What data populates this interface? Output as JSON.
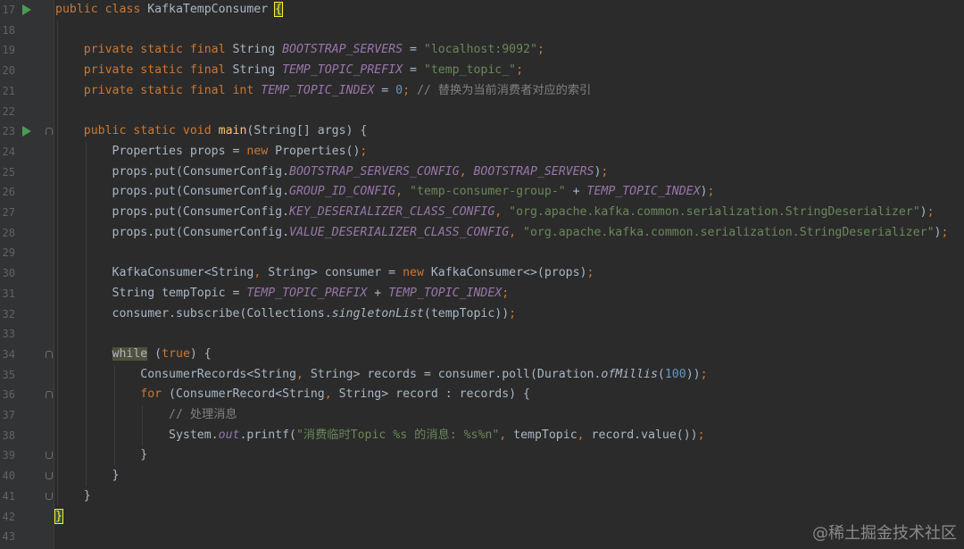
{
  "editor": {
    "lines": [
      {
        "num": "17",
        "run": true,
        "fold": null,
        "tokens": [
          [
            "kw",
            "public class "
          ],
          [
            "plain",
            "KafkaTempConsumer "
          ],
          [
            "brace",
            "{"
          ]
        ]
      },
      {
        "num": "18",
        "run": false,
        "fold": null,
        "tokens": []
      },
      {
        "num": "19",
        "run": false,
        "fold": null,
        "tokens": [
          [
            "plain",
            "    "
          ],
          [
            "kw",
            "private static final "
          ],
          [
            "plain",
            "String "
          ],
          [
            "const",
            "BOOTSTRAP_SERVERS"
          ],
          [
            "plain",
            " = "
          ],
          [
            "str",
            "\"localhost:9092\""
          ],
          [
            "kw",
            ";"
          ]
        ]
      },
      {
        "num": "20",
        "run": false,
        "fold": null,
        "tokens": [
          [
            "plain",
            "    "
          ],
          [
            "kw",
            "private static final "
          ],
          [
            "plain",
            "String "
          ],
          [
            "const",
            "TEMP_TOPIC_PREFIX"
          ],
          [
            "plain",
            " = "
          ],
          [
            "str",
            "\"temp_topic_\""
          ],
          [
            "kw",
            ";"
          ]
        ]
      },
      {
        "num": "21",
        "run": false,
        "fold": null,
        "tokens": [
          [
            "plain",
            "    "
          ],
          [
            "kw",
            "private static final int "
          ],
          [
            "const",
            "TEMP_TOPIC_INDEX"
          ],
          [
            "plain",
            " = "
          ],
          [
            "num",
            "0"
          ],
          [
            "kw",
            "; "
          ],
          [
            "com",
            "// 替换为当前消费者对应的索引"
          ]
        ]
      },
      {
        "num": "22",
        "run": false,
        "fold": null,
        "tokens": []
      },
      {
        "num": "23",
        "run": true,
        "fold": "open",
        "tokens": [
          [
            "plain",
            "    "
          ],
          [
            "kw",
            "public static void "
          ],
          [
            "fn",
            "main"
          ],
          [
            "plain",
            "(String[] args) {"
          ]
        ]
      },
      {
        "num": "24",
        "run": false,
        "fold": null,
        "tokens": [
          [
            "plain",
            "        Properties props = "
          ],
          [
            "kw",
            "new "
          ],
          [
            "plain",
            "Properties()"
          ],
          [
            "kw",
            ";"
          ]
        ]
      },
      {
        "num": "25",
        "run": false,
        "fold": null,
        "tokens": [
          [
            "plain",
            "        props.put(ConsumerConfig."
          ],
          [
            "const",
            "BOOTSTRAP_SERVERS_CONFIG"
          ],
          [
            "kw",
            ", "
          ],
          [
            "const",
            "BOOTSTRAP_SERVERS"
          ],
          [
            "plain",
            ")"
          ],
          [
            "kw",
            ";"
          ]
        ]
      },
      {
        "num": "26",
        "run": false,
        "fold": null,
        "tokens": [
          [
            "plain",
            "        props.put(ConsumerConfig."
          ],
          [
            "const",
            "GROUP_ID_CONFIG"
          ],
          [
            "kw",
            ", "
          ],
          [
            "str",
            "\"temp-consumer-group-\""
          ],
          [
            "plain",
            " + "
          ],
          [
            "const",
            "TEMP_TOPIC_INDEX"
          ],
          [
            "plain",
            ")"
          ],
          [
            "kw",
            ";"
          ]
        ]
      },
      {
        "num": "27",
        "run": false,
        "fold": null,
        "tokens": [
          [
            "plain",
            "        props.put(ConsumerConfig."
          ],
          [
            "const",
            "KEY_DESERIALIZER_CLASS_CONFIG"
          ],
          [
            "kw",
            ", "
          ],
          [
            "str",
            "\"org.apache.kafka.common.serialization.StringDeserializer\""
          ],
          [
            "plain",
            ")"
          ],
          [
            "kw",
            ";"
          ]
        ]
      },
      {
        "num": "28",
        "run": false,
        "fold": null,
        "tokens": [
          [
            "plain",
            "        props.put(ConsumerConfig."
          ],
          [
            "const",
            "VALUE_DESERIALIZER_CLASS_CONFIG"
          ],
          [
            "kw",
            ", "
          ],
          [
            "str",
            "\"org.apache.kafka.common.serialization.StringDeserializer\""
          ],
          [
            "plain",
            ")"
          ],
          [
            "kw",
            ";"
          ]
        ]
      },
      {
        "num": "29",
        "run": false,
        "fold": null,
        "tokens": []
      },
      {
        "num": "30",
        "run": false,
        "fold": null,
        "tokens": [
          [
            "plain",
            "        KafkaConsumer<String"
          ],
          [
            "kw",
            ", "
          ],
          [
            "plain",
            "String> consumer = "
          ],
          [
            "kw",
            "new "
          ],
          [
            "plain",
            "KafkaConsumer<>(props)"
          ],
          [
            "kw",
            ";"
          ]
        ]
      },
      {
        "num": "31",
        "run": false,
        "fold": null,
        "tokens": [
          [
            "plain",
            "        String tempTopic = "
          ],
          [
            "const",
            "TEMP_TOPIC_PREFIX"
          ],
          [
            "plain",
            " + "
          ],
          [
            "const",
            "TEMP_TOPIC_INDEX"
          ],
          [
            "kw",
            ";"
          ]
        ]
      },
      {
        "num": "32",
        "run": false,
        "fold": null,
        "tokens": [
          [
            "plain",
            "        consumer.subscribe(Collections."
          ],
          [
            "stat",
            "singletonList"
          ],
          [
            "plain",
            "(tempTopic))"
          ],
          [
            "kw",
            ";"
          ]
        ]
      },
      {
        "num": "33",
        "run": false,
        "fold": null,
        "tokens": []
      },
      {
        "num": "34",
        "run": false,
        "fold": "open",
        "tokens": [
          [
            "plain",
            "        "
          ],
          [
            "while",
            "while"
          ],
          [
            "plain",
            " ("
          ],
          [
            "kw",
            "true"
          ],
          [
            "plain",
            ") {"
          ]
        ]
      },
      {
        "num": "35",
        "run": false,
        "fold": null,
        "tokens": [
          [
            "plain",
            "            ConsumerRecords<String"
          ],
          [
            "kw",
            ", "
          ],
          [
            "plain",
            "String> records = consumer.poll(Duration."
          ],
          [
            "stat",
            "ofMillis"
          ],
          [
            "plain",
            "("
          ],
          [
            "num",
            "100"
          ],
          [
            "plain",
            "))"
          ],
          [
            "kw",
            ";"
          ]
        ]
      },
      {
        "num": "36",
        "run": false,
        "fold": "open",
        "tokens": [
          [
            "plain",
            "            "
          ],
          [
            "kw",
            "for "
          ],
          [
            "plain",
            "(ConsumerRecord<String"
          ],
          [
            "kw",
            ", "
          ],
          [
            "plain",
            "String> record : records) {"
          ]
        ]
      },
      {
        "num": "37",
        "run": false,
        "fold": null,
        "tokens": [
          [
            "plain",
            "                "
          ],
          [
            "com",
            "// 处理消息"
          ]
        ]
      },
      {
        "num": "38",
        "run": false,
        "fold": null,
        "tokens": [
          [
            "plain",
            "                System."
          ],
          [
            "const",
            "out"
          ],
          [
            "plain",
            ".printf("
          ],
          [
            "str",
            "\"消费临时Topic %s 的消息: %s%n\""
          ],
          [
            "kw",
            ", "
          ],
          [
            "plain",
            "tempTopic"
          ],
          [
            "kw",
            ", "
          ],
          [
            "plain",
            "record.value())"
          ],
          [
            "kw",
            ";"
          ]
        ]
      },
      {
        "num": "39",
        "run": false,
        "fold": "close",
        "tokens": [
          [
            "plain",
            "            }"
          ]
        ]
      },
      {
        "num": "40",
        "run": false,
        "fold": "close",
        "tokens": [
          [
            "plain",
            "        }"
          ]
        ]
      },
      {
        "num": "41",
        "run": false,
        "fold": "close",
        "tokens": [
          [
            "plain",
            "    }"
          ]
        ]
      },
      {
        "num": "42",
        "run": false,
        "fold": null,
        "tokens": [
          [
            "brace",
            "}"
          ]
        ]
      },
      {
        "num": "43",
        "run": false,
        "fold": null,
        "tokens": []
      }
    ]
  },
  "watermark": "@稀土掘金技术社区",
  "colors": {
    "background": "#2b2b2b",
    "gutter": "#313335",
    "keyword": "#cc7832",
    "string": "#6a8759",
    "constant": "#9876aa",
    "function": "#ffc66d",
    "number": "#6897bb",
    "comment": "#808080",
    "run_icon": "#499c54"
  },
  "icons": {
    "run": "run-gutter-icon",
    "fold_open": "fold-open-icon",
    "fold_close": "fold-close-icon"
  }
}
